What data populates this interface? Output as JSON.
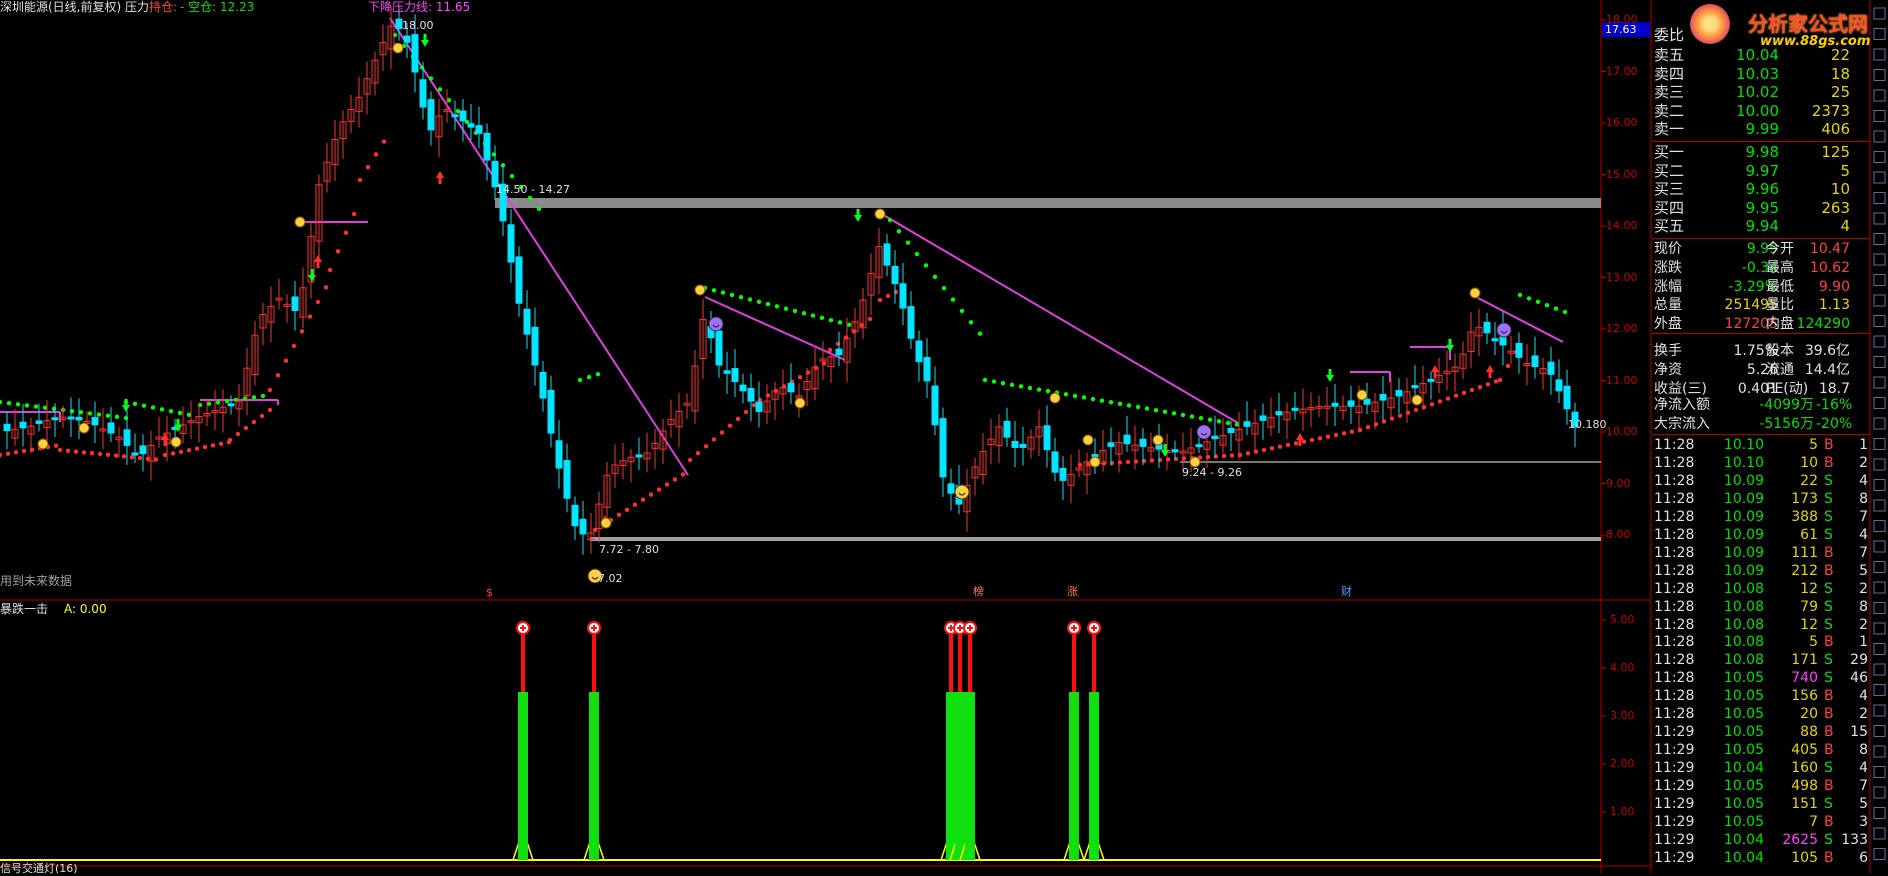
{
  "header": {
    "title": "深圳能源(日线,前复权) 压力",
    "position_label": "持仓:",
    "position_value": "- 空仓: 12.23",
    "downtrend_label": "下降压力线: 11.65"
  },
  "main_chart": {
    "y_axis_labels": [
      "18.00",
      "17.00",
      "16.00",
      "15.00",
      "14.00",
      "13.00",
      "12.00",
      "11.00",
      "10.00",
      "9.00",
      "8.00"
    ],
    "current_price_tag": "17.63",
    "last_price_label": "10.180",
    "zone_labels": [
      "14.50 - 14.27",
      "9.24 - 9.26",
      "7.72 - 7.80"
    ],
    "high_label": "18.00",
    "low_label": "7.02",
    "future_data_note": "用到未来数据",
    "event_markers": [
      "$",
      "榜",
      "涨",
      "财"
    ]
  },
  "indicator": {
    "title": "暴跌一击",
    "value_label": "A: 0.00",
    "y_axis_labels": [
      "5.00",
      "4.00",
      "3.00",
      "2.00",
      "1.00"
    ]
  },
  "bottom_tab": "信号交通灯(16)",
  "logo": {
    "title": "分析家公式网",
    "url": "www.88gs.com"
  },
  "order_book": {
    "commit_ratio_label": "委比",
    "asks": [
      {
        "label": "卖五",
        "price": "10.04",
        "vol": "22"
      },
      {
        "label": "卖四",
        "price": "10.03",
        "vol": "18"
      },
      {
        "label": "卖三",
        "price": "10.02",
        "vol": "25"
      },
      {
        "label": "卖二",
        "price": "10.00",
        "vol": "2373"
      },
      {
        "label": "卖一",
        "price": "9.99",
        "vol": "406"
      }
    ],
    "bids": [
      {
        "label": "买一",
        "price": "9.98",
        "vol": "125"
      },
      {
        "label": "买二",
        "price": "9.97",
        "vol": "5"
      },
      {
        "label": "买三",
        "price": "9.96",
        "vol": "10"
      },
      {
        "label": "买四",
        "price": "9.95",
        "vol": "263"
      },
      {
        "label": "买五",
        "price": "9.94",
        "vol": "4"
      }
    ]
  },
  "quote": {
    "rows": [
      {
        "l1": "现价",
        "v1": "9.99",
        "l2": "今开",
        "v2": "10.47"
      },
      {
        "l1": "涨跌",
        "v1": "-0.34",
        "l2": "最高",
        "v2": "10.62"
      },
      {
        "l1": "涨幅",
        "v1": "-3.29%",
        "l2": "最低",
        "v2": "9.90"
      },
      {
        "l1": "总量",
        "v1": "251495",
        "l2": "量比",
        "v2": "1.13"
      },
      {
        "l1": "外盘",
        "v1": "127205",
        "l2": "内盘",
        "v2": "124290"
      },
      {
        "l1": "换手",
        "v1": "1.75%",
        "l2": "股本",
        "v2": "39.6亿"
      },
      {
        "l1": "净资",
        "v1": "5.26",
        "l2": "流通",
        "v2": "14.4亿"
      },
      {
        "l1": "收益(三)",
        "v1": "0.401",
        "l2": "PE(动)",
        "v2": "18.7"
      }
    ],
    "flows": [
      {
        "label": "净流入额",
        "value": "-4099万",
        "pct": "-16%"
      },
      {
        "label": "大宗流入",
        "value": "-5156万",
        "pct": "-20%"
      }
    ]
  },
  "ticks": [
    {
      "t": "11:28",
      "p": "10.10",
      "v": "5",
      "s": "B",
      "n": "1"
    },
    {
      "t": "11:28",
      "p": "10.10",
      "v": "10",
      "s": "B",
      "n": "2"
    },
    {
      "t": "11:28",
      "p": "10.09",
      "v": "22",
      "s": "S",
      "n": "4"
    },
    {
      "t": "11:28",
      "p": "10.09",
      "v": "173",
      "s": "S",
      "n": "8"
    },
    {
      "t": "11:28",
      "p": "10.09",
      "v": "388",
      "s": "S",
      "n": "7"
    },
    {
      "t": "11:28",
      "p": "10.09",
      "v": "61",
      "s": "S",
      "n": "4"
    },
    {
      "t": "11:28",
      "p": "10.09",
      "v": "111",
      "s": "B",
      "n": "7"
    },
    {
      "t": "11:28",
      "p": "10.09",
      "v": "212",
      "s": "B",
      "n": "5"
    },
    {
      "t": "11:28",
      "p": "10.08",
      "v": "12",
      "s": "S",
      "n": "2"
    },
    {
      "t": "11:28",
      "p": "10.08",
      "v": "79",
      "s": "S",
      "n": "8"
    },
    {
      "t": "11:28",
      "p": "10.08",
      "v": "12",
      "s": "S",
      "n": "2"
    },
    {
      "t": "11:28",
      "p": "10.08",
      "v": "5",
      "s": "B",
      "n": "1"
    },
    {
      "t": "11:28",
      "p": "10.08",
      "v": "171",
      "s": "S",
      "n": "29"
    },
    {
      "t": "11:28",
      "p": "10.05",
      "v": "740",
      "s": "S",
      "n": "46"
    },
    {
      "t": "11:28",
      "p": "10.05",
      "v": "156",
      "s": "B",
      "n": "4"
    },
    {
      "t": "11:28",
      "p": "10.05",
      "v": "20",
      "s": "B",
      "n": "2"
    },
    {
      "t": "11:29",
      "p": "10.05",
      "v": "88",
      "s": "B",
      "n": "15"
    },
    {
      "t": "11:29",
      "p": "10.05",
      "v": "405",
      "s": "B",
      "n": "8"
    },
    {
      "t": "11:29",
      "p": "10.04",
      "v": "160",
      "s": "S",
      "n": "4"
    },
    {
      "t": "11:29",
      "p": "10.05",
      "v": "498",
      "s": "B",
      "n": "7"
    },
    {
      "t": "11:29",
      "p": "10.05",
      "v": "151",
      "s": "S",
      "n": "5"
    },
    {
      "t": "11:29",
      "p": "10.05",
      "v": "7",
      "s": "B",
      "n": "3"
    },
    {
      "t": "11:29",
      "p": "10.04",
      "v": "2625",
      "s": "S",
      "n": "133"
    },
    {
      "t": "11:29",
      "p": "10.04",
      "v": "105",
      "s": "B",
      "n": "6"
    }
  ],
  "colors": {
    "up": "#ff3030",
    "down": "#00e5ff",
    "axis": "#c00000",
    "magenta": "#e040e0",
    "green": "#00ff00",
    "yellow": "#ffff00"
  }
}
